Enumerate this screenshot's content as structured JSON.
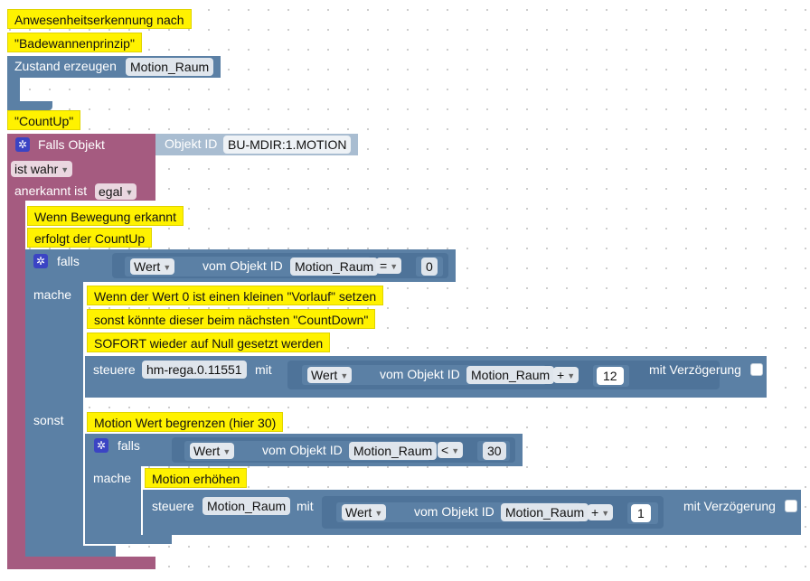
{
  "comments": {
    "c1": "Anwesenheitserkennung nach",
    "c2": "\"Badewannenprinzip\"",
    "c3": "\"CountUp\"",
    "c4": "Wenn Bewegung erkannt",
    "c5": "erfolgt der CountUp",
    "c6": "Wenn der Wert 0 ist einen kleinen \"Vorlauf\" setzen",
    "c7": "sonst könnte dieser beim nächsten \"CountDown\"",
    "c8": "SOFORT wieder auf Null gesetzt werden",
    "c9": "Motion Wert begrenzen (hier 30)",
    "c10": "Motion erhöhen"
  },
  "create_state": {
    "label": "Zustand erzeugen",
    "name": "Motion_Raum"
  },
  "trigger": {
    "label": "Falls Objekt",
    "object_id_label": "Objekt ID",
    "object_id": "BU-MDIR:1.MOTION",
    "condition": "ist wahr",
    "ack_label": "anerkannt ist",
    "ack_value": "egal"
  },
  "if1": {
    "falls": "falls",
    "mache": "mache",
    "sonst": "sonst",
    "prop": "Wert",
    "of_obj": "vom Objekt ID",
    "obj": "Motion_Raum",
    "op": "=",
    "value": "0"
  },
  "control1": {
    "steuere": "steuere",
    "target": "hm-rega.0.11551",
    "mit": "mit",
    "prop": "Wert",
    "of_obj": "vom Objekt ID",
    "obj": "Motion_Raum",
    "op": "+",
    "value": "12",
    "delay": "mit Verzögerung"
  },
  "if2": {
    "falls": "falls",
    "mache": "mache",
    "prop": "Wert",
    "of_obj": "vom Objekt ID",
    "obj": "Motion_Raum",
    "op": "<",
    "value": "30"
  },
  "control2": {
    "steuere": "steuere",
    "target": "Motion_Raum",
    "mit": "mit",
    "prop": "Wert",
    "of_obj": "vom Objekt ID",
    "obj": "Motion_Raum",
    "op": "+",
    "value": "1",
    "delay": "mit Verzögerung"
  },
  "colors": {
    "blue_block": "#5b80a5",
    "magenta_block": "#a55b80",
    "comment": "#fff200",
    "gear": "#3b44c4"
  }
}
